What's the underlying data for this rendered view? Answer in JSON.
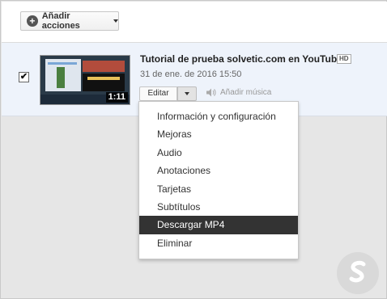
{
  "toolbar": {
    "add_actions_label": "Añadir acciones"
  },
  "video": {
    "checked": true,
    "check_mark": "✔",
    "duration": "1:11",
    "title": "Tutorial de prueba solvetic.com en YouTube",
    "hd_badge": "HD",
    "date": "31 de ene. de 2016 15:50",
    "edit_label": "Editar",
    "add_music_label": "Añadir música"
  },
  "menu": {
    "items": [
      {
        "label": "Información y configuración",
        "active": false
      },
      {
        "label": "Mejoras",
        "active": false
      },
      {
        "label": "Audio",
        "active": false
      },
      {
        "label": "Anotaciones",
        "active": false
      },
      {
        "label": "Tarjetas",
        "active": false
      },
      {
        "label": "Subtítulos",
        "active": false
      },
      {
        "label": "Descargar MP4",
        "active": true
      },
      {
        "label": "Eliminar",
        "active": false
      }
    ]
  },
  "colors": {
    "row_selected_bg": "#eef3fb",
    "menu_active_bg": "#333333",
    "logo_circle": "#d9d9d9"
  }
}
